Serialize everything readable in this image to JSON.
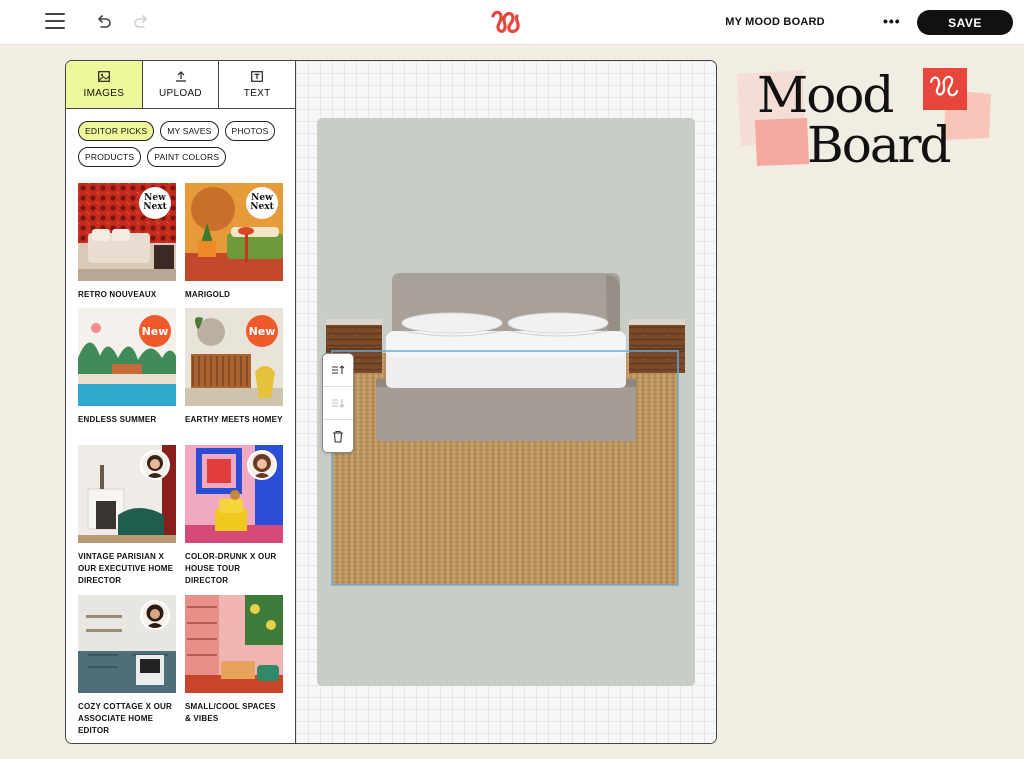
{
  "topbar": {
    "board_title": "MY MOOD BOARD",
    "save_label": "SAVE",
    "more_label": "•••"
  },
  "panel": {
    "tabs": [
      {
        "label": "IMAGES",
        "icon": "image-icon",
        "active": true
      },
      {
        "label": "UPLOAD",
        "icon": "upload-icon",
        "active": false
      },
      {
        "label": "TEXT",
        "icon": "text-icon",
        "active": false
      }
    ],
    "filters": [
      {
        "label": "EDITOR PICKS",
        "active": true
      },
      {
        "label": "MY SAVES",
        "active": false
      },
      {
        "label": "PHOTOS",
        "active": false
      },
      {
        "label": "PRODUCTS",
        "active": false
      },
      {
        "label": "PAINT COLORS",
        "active": false
      }
    ],
    "cards": [
      {
        "caption": "RETRO NOUVEAUX",
        "badge": "new-next"
      },
      {
        "caption": "MARIGOLD",
        "badge": "new-next"
      },
      {
        "caption": "ENDLESS SUMMER",
        "badge": "New"
      },
      {
        "caption": "EARTHY MEETS HOMEY",
        "badge": "New"
      },
      {
        "caption": "VINTAGE PARISIAN X OUR EXECUTIVE HOME DIRECTOR",
        "badge": "avatar"
      },
      {
        "caption": "COLOR-DRUNK X OUR HOUSE TOUR DIRECTOR",
        "badge": "avatar"
      },
      {
        "caption": "COZY COTTAGE X OUR ASSOCIATE HOME EDITOR",
        "badge": "avatar"
      },
      {
        "caption": "SMALL/COOL SPACES & VIBES",
        "badge": ""
      }
    ],
    "badge_new_text": "New",
    "badge_nn_line1": "New",
    "badge_nn_line2": "Next"
  },
  "heading": {
    "line1": "Mood",
    "line2": "Board"
  },
  "colors": {
    "accent_yellow": "#eef79a",
    "brand_red": "#e8463c",
    "badge_orange": "#f05a2a",
    "board_bg": "#c8cdc5",
    "page_bg": "#f1ede3"
  }
}
